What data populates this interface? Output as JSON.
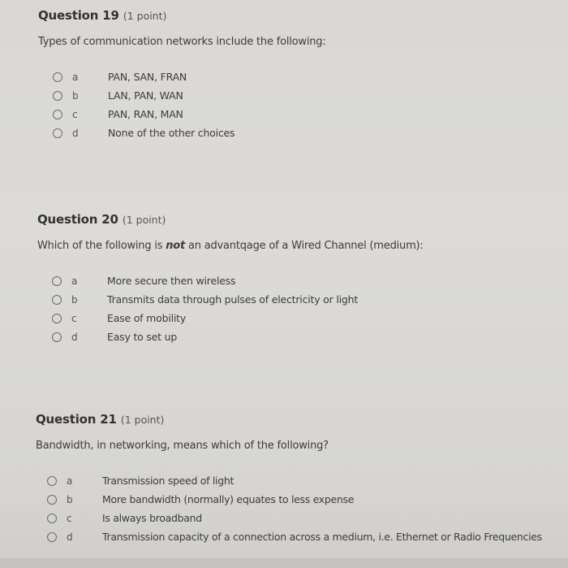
{
  "questions": [
    {
      "title": "Question 19",
      "points": "(1 point)",
      "text_before": "Types of communication networks include the following:",
      "text_emphasis": "",
      "text_after": "",
      "options": [
        {
          "letter": "a",
          "text": "PAN, SAN, FRAN",
          "selected": false
        },
        {
          "letter": "b",
          "text": "LAN, PAN, WAN",
          "selected": false
        },
        {
          "letter": "c",
          "text": "PAN, RAN, MAN",
          "selected": false
        },
        {
          "letter": "d",
          "text": "None of the other choices",
          "selected": false
        }
      ]
    },
    {
      "title": "Question 20",
      "points": "(1 point)",
      "text_before": "Which of the following is ",
      "text_emphasis": "not",
      "text_after": " an advantqage of a Wired Channel (medium):",
      "options": [
        {
          "letter": "a",
          "text": "More secure then wireless",
          "selected": false
        },
        {
          "letter": "b",
          "text": "Transmits data through pulses of electricity or light",
          "selected": false
        },
        {
          "letter": "c",
          "text": "Ease of mobility",
          "selected": false
        },
        {
          "letter": "d",
          "text": "Easy to set up",
          "selected": false
        }
      ]
    },
    {
      "title": "Question 21",
      "points": "(1 point)",
      "text_before": "Bandwidth, in networking, means which of the following?",
      "text_emphasis": "",
      "text_after": "",
      "options": [
        {
          "letter": "a",
          "text": "Transmission speed of light",
          "selected": false
        },
        {
          "letter": "b",
          "text": "More bandwidth (normally) equates to less expense",
          "selected": false
        },
        {
          "letter": "c",
          "text": "Is always broadband",
          "selected": false
        },
        {
          "letter": "d",
          "text": "Transmission capacity of a connection across a medium, i.e. Ethernet or Radio Frequencies",
          "selected": false
        }
      ]
    }
  ]
}
